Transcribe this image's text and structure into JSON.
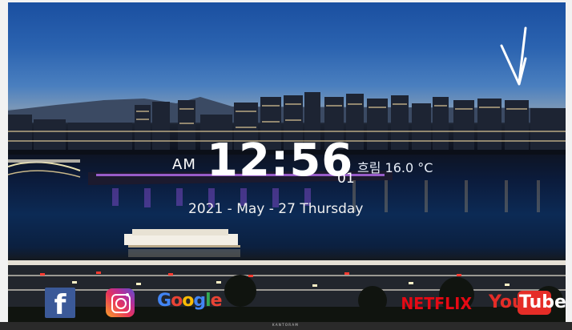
{
  "clock": {
    "ampm": "AM",
    "time": "12:56",
    "seconds": "01"
  },
  "weather": {
    "condition": "흐림",
    "temperature": "16.0 °C"
  },
  "date": {
    "text": "2021 - May - 27  Thursday"
  },
  "apps": {
    "facebook": {
      "glyph": "f",
      "color": "#3b5998"
    },
    "instagram": {
      "color": "#e8355b"
    },
    "google": {
      "letters": [
        "G",
        "o",
        "o",
        "g",
        "l",
        "e"
      ],
      "colors": [
        "#4285f4",
        "#ea4335",
        "#fbbc05",
        "#4285f4",
        "#34a853",
        "#ea4335"
      ]
    },
    "netflix": {
      "label": "NETFLIX",
      "color": "#e50914"
    },
    "youtube": {
      "you": "You",
      "tube": "Tube",
      "color": "#e52d27"
    }
  },
  "footer": {
    "label": "K A N T O R A M"
  }
}
